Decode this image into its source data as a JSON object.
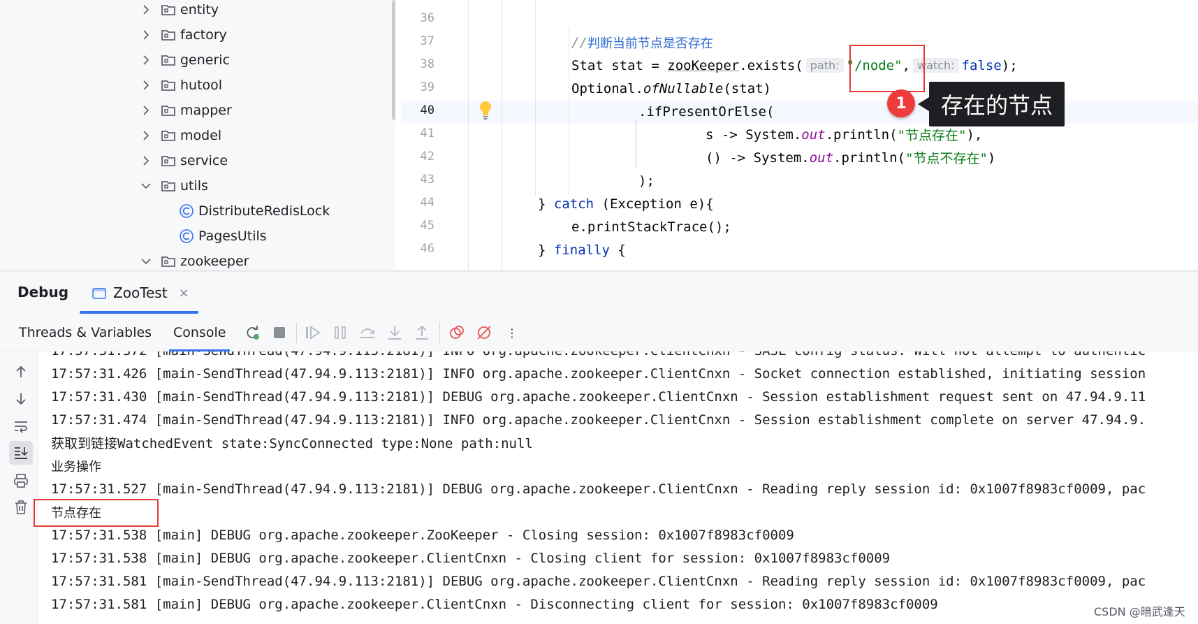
{
  "tree": {
    "items": [
      {
        "label": "entity",
        "kind": "folder",
        "expanded": false
      },
      {
        "label": "factory",
        "kind": "folder",
        "expanded": false
      },
      {
        "label": "generic",
        "kind": "folder",
        "expanded": false
      },
      {
        "label": "hutool",
        "kind": "folder",
        "expanded": false
      },
      {
        "label": "mapper",
        "kind": "folder",
        "expanded": false
      },
      {
        "label": "model",
        "kind": "folder",
        "expanded": false
      },
      {
        "label": "service",
        "kind": "folder",
        "expanded": false
      },
      {
        "label": "utils",
        "kind": "folder",
        "expanded": true
      },
      {
        "label": "DistributeRedisLock",
        "kind": "class"
      },
      {
        "label": "PagesUtils",
        "kind": "class"
      },
      {
        "label": "zookeeper",
        "kind": "folder",
        "expanded": true
      }
    ]
  },
  "editor": {
    "line_numbers": [
      "36",
      "37",
      "38",
      "39",
      "40",
      "41",
      "42",
      "43",
      "44",
      "45",
      "46"
    ],
    "current_line": "40",
    "code": {
      "l37_comment_slashes": "//",
      "l37_comment_text": "判断当前节点是否存在",
      "l38_a": "Stat stat = ",
      "l38_zk": "zooKeeper",
      "l38_b": ".exists(",
      "l38_hint_path": "path:",
      "l38_str": "\"/node\"",
      "l38_comma": ",",
      "l38_hint_watch": "watch:",
      "l38_false": "false",
      "l38_end": ");",
      "l39_a": "Optional.",
      "l39_method": "ofNullable",
      "l39_b": "(stat)",
      "l40": ".ifPresentOrElse(",
      "l41_a": "s -> System.",
      "l41_out": "out",
      "l41_b": ".println(",
      "l41_str": "\"节点存在\"",
      "l41_c": "),",
      "l42_a": "() -> System.",
      "l42_out": "out",
      "l42_b": ".println(",
      "l42_str": "\"节点不存在\"",
      "l42_c": ")",
      "l43": ");",
      "l44_a": "} ",
      "l44_kw": "catch",
      "l44_b": " (Exception e){",
      "l45": "e.printStackTrace();",
      "l46_a": "} ",
      "l46_kw": "finally",
      "l46_b": " {"
    },
    "annotation": {
      "badge": "1",
      "tooltip": "存在的节点"
    }
  },
  "debug": {
    "title": "Debug",
    "session_tab": "ZooTest",
    "close_glyph": "×",
    "tabs": [
      "Threads & Variables",
      "Console"
    ],
    "more_glyph": "⋮"
  },
  "console": {
    "lines": [
      "17:57:31.426 [main-SendThread(47.94.9.113:2181)] INFO org.apache.zookeeper.ClientCnxn - Socket connection established, initiating session",
      "17:57:31.430 [main-SendThread(47.94.9.113:2181)] DEBUG org.apache.zookeeper.ClientCnxn - Session establishment request sent on 47.94.9.11",
      "17:57:31.474 [main-SendThread(47.94.9.113:2181)] INFO org.apache.zookeeper.ClientCnxn - Session establishment complete on server 47.94.9.",
      "获取到链接WatchedEvent state:SyncConnected type:None path:null",
      "业务操作",
      "17:57:31.527 [main-SendThread(47.94.9.113:2181)] DEBUG org.apache.zookeeper.ClientCnxn - Reading reply session id: 0x1007f8983cf0009, pac",
      "节点存在",
      "17:57:31.538 [main] DEBUG org.apache.zookeeper.ZooKeeper - Closing session: 0x1007f8983cf0009",
      "17:57:31.538 [main] DEBUG org.apache.zookeeper.ClientCnxn - Closing client for session: 0x1007f8983cf0009",
      "17:57:31.581 [main-SendThread(47.94.9.113:2181)] DEBUG org.apache.zookeeper.ClientCnxn - Reading reply session id: 0x1007f8983cf0009, pac",
      "17:57:31.581 [main] DEBUG org.apache.zookeeper.ClientCnxn - Disconnecting client for session: 0x1007f8983cf0009"
    ]
  },
  "watermark": "CSDN @暗武逢天",
  "colors": {
    "accent": "#3574f0",
    "annotation_red": "#e53935",
    "keyword": "#0033b3",
    "string": "#067d17"
  }
}
